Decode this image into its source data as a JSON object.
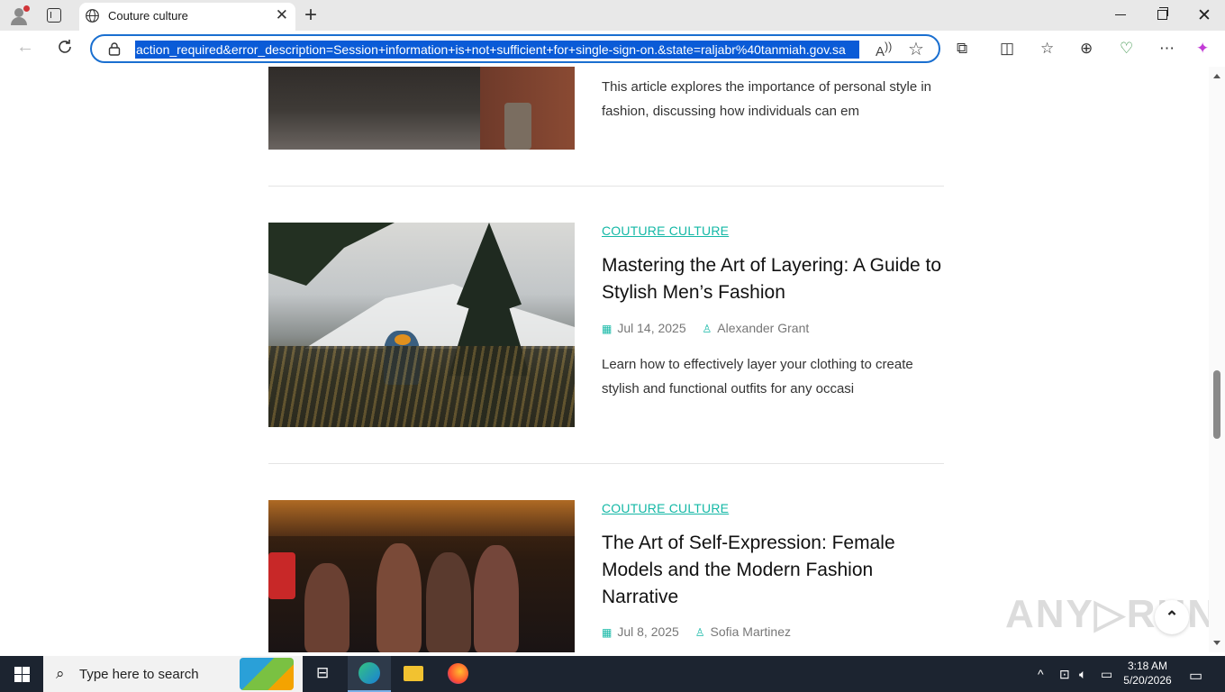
{
  "browser": {
    "tab_title": "Couture culture",
    "url": "action_required&error_description=Session+information+is+not+sufficient+for+single-sign-on.&state=raljabr%40tanmiah.gov.sa",
    "icons": [
      "profile-icon",
      "tab-actions-icon",
      "globe-icon",
      "close-icon",
      "new-tab-icon",
      "back-icon",
      "reload-icon",
      "lock-icon",
      "read-aloud-icon",
      "favorite-icon",
      "extensions-icon",
      "split-screen-icon",
      "favorites-icon",
      "collections-icon",
      "performance-icon",
      "more-icon",
      "copilot-icon"
    ]
  },
  "articles": [
    {
      "excerpt": "This article explores the importance of personal style in fashion, discussing how individuals can em"
    },
    {
      "category": "COUTURE CULTURE",
      "title": "Mastering the Art of Layering: A Guide to Stylish Men’s Fashion",
      "date": "Jul 14, 2025",
      "author": "Alexander Grant",
      "excerpt": "Learn how to effectively layer your clothing to create stylish and functional outfits for any occasi"
    },
    {
      "category": "COUTURE CULTURE",
      "title": "The Art of Self-Expression: Female Models and the Modern Fashion Narrative",
      "date": "Jul 8, 2025",
      "author": "Sofia Martinez"
    }
  ],
  "taskbar": {
    "search_placeholder": "Type here to search",
    "time": "3:18 AM",
    "date": "5/20/2026"
  }
}
